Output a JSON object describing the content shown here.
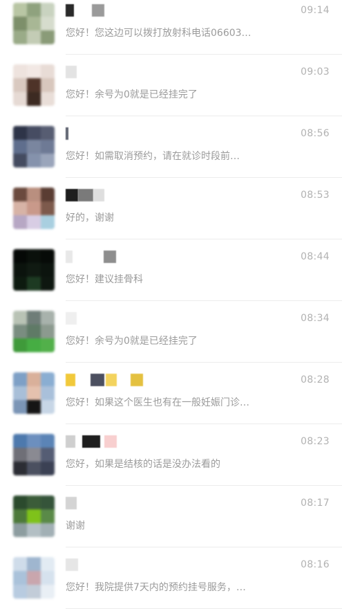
{
  "conversations": [
    {
      "time": "09:14",
      "preview": "您好！您这边可以拨打放射科电话06603…",
      "avatar_colors": [
        "#b9c6a4",
        "#8fa27e",
        "#c9d3c0",
        "#7d8f6a",
        "#a8b795",
        "#d6dccd",
        "#9aab88",
        "#c3ccb5",
        "#8a9b78"
      ]
    },
    {
      "time": "09:03",
      "preview": "您好！余号为0就是已经挂完了",
      "avatar_colors": [
        "#eee3de",
        "#f2e8e4",
        "#e8dcd6",
        "#d9c9c0",
        "#4e3328",
        "#d8c7bd",
        "#e6dad4",
        "#3c2a22",
        "#e9ded8"
      ]
    },
    {
      "time": "08:56",
      "preview": "您好！如需取消预约，请在就诊时段前…",
      "avatar_colors": [
        "#2e3448",
        "#464c62",
        "#575d72",
        "#5f6e8d",
        "#7a869f",
        "#6e7a95",
        "#444b60",
        "#8592ac",
        "#9aa5bb"
      ]
    },
    {
      "time": "08:53",
      "preview": "好的，谢谢",
      "avatar_colors": [
        "#6b4a3e",
        "#b98f7f",
        "#5a3d33",
        "#d7b3a6",
        "#c9998a",
        "#7d5a4c",
        "#b7a7c4",
        "#d8cde4",
        "#a9cfe0"
      ]
    },
    {
      "time": "08:44",
      "preview": "您好！建议挂骨科",
      "avatar_colors": [
        "#050806",
        "#0a100b",
        "#070b08",
        "#0b130d",
        "#101a12",
        "#0c140e",
        "#0d1a0f",
        "#1d3a22",
        "#0e1710"
      ]
    },
    {
      "time": "08:34",
      "preview": "您好！余号为0就是已经挂完了",
      "avatar_colors": [
        "#b9c3b5",
        "#6f7d78",
        "#a8b2ac",
        "#7a8d80",
        "#5f7a66",
        "#8c9a8f",
        "#3f9a3a",
        "#46ad43",
        "#52b04a"
      ]
    },
    {
      "time": "08:28",
      "preview": "您好！如果这个医生也有在一般妊娠门诊…",
      "avatar_colors": [
        "#7ea0c6",
        "#d9b09a",
        "#8aaed2",
        "#a8bfd8",
        "#e4c1ae",
        "#a9c0da",
        "#7b95b6",
        "#151515",
        "#c7d6e6"
      ]
    },
    {
      "time": "08:23",
      "preview": "您好，如果是结核的话是没办法看的",
      "avatar_colors": [
        "#4d79ad",
        "#6c8fbe",
        "#5b84b6",
        "#6f6f77",
        "#8a8a92",
        "#555d74",
        "#2c2d34",
        "#4b5060",
        "#3b4154"
      ]
    },
    {
      "time": "08:17",
      "preview": "谢谢",
      "avatar_colors": [
        "#2b4a2d",
        "#3b5c39",
        "#35543a",
        "#4d7a3a",
        "#7fc21a",
        "#5a8a48",
        "#8d9da0",
        "#b3bfc4",
        "#a2b0b5"
      ]
    },
    {
      "time": "08:16",
      "preview": "您好！我院提供7天内的预约挂号服务，…",
      "avatar_colors": [
        "#cfdcea",
        "#9fb6cf",
        "#e2ebf3",
        "#aac2da",
        "#c9a6ad",
        "#d6e2ee",
        "#b8cbe0",
        "#c2ccd8",
        "#e9eff5"
      ]
    }
  ],
  "name_blocks": [
    [
      {
        "color": "#2a2a2a"
      },
      {
        "color": "#9a9a9a"
      }
    ],
    [
      {
        "color": "#e3e3e3"
      }
    ],
    [
      {
        "color": "#5e6370"
      }
    ],
    [
      {
        "color": "#1e1e1e"
      },
      {
        "color": "#7a7a7a"
      },
      {
        "color": "#dedede"
      }
    ],
    [
      {
        "color": "#e8e8e8"
      },
      {
        "color": "#8e8e8e"
      }
    ],
    [
      {
        "color": "#efefef"
      }
    ],
    [
      {
        "color": "#f1c93b"
      },
      {
        "color": "#4c5060"
      },
      {
        "color": "#f3d35e"
      },
      {
        "color": "#e4c140"
      }
    ],
    [
      {
        "color": "#cfcfcf"
      },
      {
        "color": "#1e1e1e"
      },
      {
        "color": "#f8cfcf"
      }
    ],
    [
      {
        "color": "#d4d4d4"
      }
    ],
    [
      {
        "color": "#e6e6e6"
      }
    ]
  ],
  "colors": {
    "time_text": "#b2b2b2",
    "preview_text": "#9b9b9b",
    "divider": "#ececec"
  }
}
